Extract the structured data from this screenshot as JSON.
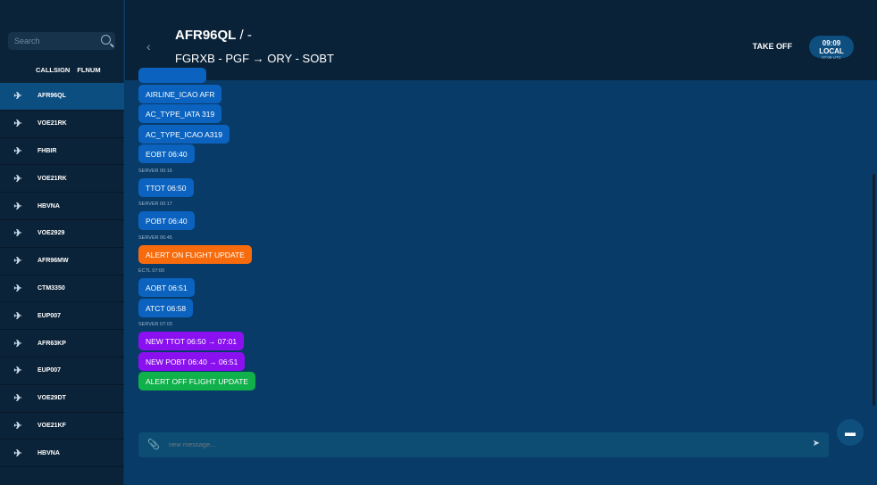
{
  "sidebar": {
    "search_placeholder": "Search",
    "columns": [
      "CALLSIGN",
      "FLNUM"
    ],
    "items": [
      "AFR96QL",
      "VOE21RK",
      "FHBIR",
      "VOE21RK",
      "HBVNA",
      "VOE2929",
      "AFR96MW",
      "CTM3350",
      "EUP007",
      "AFR63KP",
      "EUP007",
      "VOE29DT",
      "VOE21KF",
      "HBVNA"
    ],
    "selected": "AFR96QL"
  },
  "header": {
    "callsign": "AFR96QL",
    "suffix": " / -",
    "subtitle": "FGRXB - PGF → ORY - SOBT",
    "status": "TAKE OFF",
    "local_time": "09:09 LOCAL",
    "utc_time": "07:09 UTC",
    "back": "‹"
  },
  "messages": [
    {
      "type": "bubble",
      "color": "blue",
      "text": "AIRLINE_ICAO AFR"
    },
    {
      "type": "bubble",
      "color": "blue",
      "text": "AC_TYPE_IATA 319"
    },
    {
      "type": "bubble",
      "color": "blue",
      "text": "AC_TYPE_ICAO A319"
    },
    {
      "type": "bubble",
      "color": "blue",
      "text": "EOBT 06:40"
    },
    {
      "type": "ts",
      "text": "SERVER 00:16"
    },
    {
      "type": "bubble",
      "color": "blue",
      "text": "TTOT 06:50"
    },
    {
      "type": "ts",
      "text": "SERVER 00:17"
    },
    {
      "type": "bubble",
      "color": "blue",
      "text": "POBT 06:40"
    },
    {
      "type": "ts",
      "text": "SERVER 06:45"
    },
    {
      "type": "bubble",
      "color": "orange",
      "text": "ALERT ON FLIGHT UPDATE"
    },
    {
      "type": "ts",
      "text": "ECTL 07:00"
    },
    {
      "type": "bubble",
      "color": "blue",
      "text": "AOBT 06:51"
    },
    {
      "type": "bubble",
      "color": "blue",
      "text": "ATCT 06:58"
    },
    {
      "type": "ts",
      "text": "SERVER 07:03"
    },
    {
      "type": "bubble",
      "color": "purple",
      "text": "NEW TTOT 06:50 → 07:01"
    },
    {
      "type": "bubble",
      "color": "purple",
      "text": "NEW POBT 06:40 → 06:51"
    },
    {
      "type": "bubble",
      "color": "green",
      "text": "ALERT OFF FLIGHT UPDATE"
    }
  ],
  "composer": {
    "placeholder": "new message..."
  },
  "colors": {
    "blue": "#0b63bf",
    "orange": "#f76b0c",
    "purple": "#8a10f0",
    "green": "#10b04a"
  }
}
